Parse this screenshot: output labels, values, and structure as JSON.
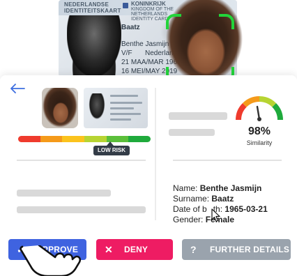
{
  "id_card": {
    "country": "NEDERLANDSE IDENTITEITSKAART",
    "kingdom_title": "KONINKRIJK",
    "kingdom_sub": "KINGDOM OF THE NETHERLANDS IDENTITY CARD",
    "surname": "Baatz",
    "given_names": "Benthe Jasmijn",
    "sex": "V/F",
    "nationality": "Nederlandse",
    "date_of_birth": "21 MAA/MAR 1965",
    "date_of_expiry": "16 MEI/MAY 2019"
  },
  "panel": {
    "back_icon": "arrow-left-icon",
    "risk": {
      "label": "LOW RISK",
      "level": "low",
      "segments": [
        "#ef3b2d",
        "#f59a1a",
        "#fbc31d",
        "#b7d432",
        "#5bbf3a",
        "#1faa3c"
      ]
    },
    "similarity": {
      "value": "98%",
      "label": "Similarity",
      "score": 0.98
    },
    "details": {
      "name_label": "Name:",
      "name_value": "Benthe Jasmijn",
      "surname_label": "Surname:",
      "surname_value": "Baatz",
      "dob_label": "Date of birth:",
      "dob_label_visible": "Date of b",
      "dob_label_tail": "th:",
      "dob_value": "1965-03-21",
      "gender_label": "Gender:",
      "gender_value": "Female"
    }
  },
  "buttons": {
    "approve": {
      "label": "APPROVE",
      "icon": "check-icon",
      "color": "#3f63e0"
    },
    "deny": {
      "label": "DENY",
      "icon": "close-icon",
      "color": "#ee1c63"
    },
    "further": {
      "label": "FURTHER DETAILS",
      "icon": "question-icon",
      "color": "#9aa3ad"
    }
  },
  "colors": {
    "scan_frame": "#22d43a",
    "accent": "#3d6ee0"
  }
}
